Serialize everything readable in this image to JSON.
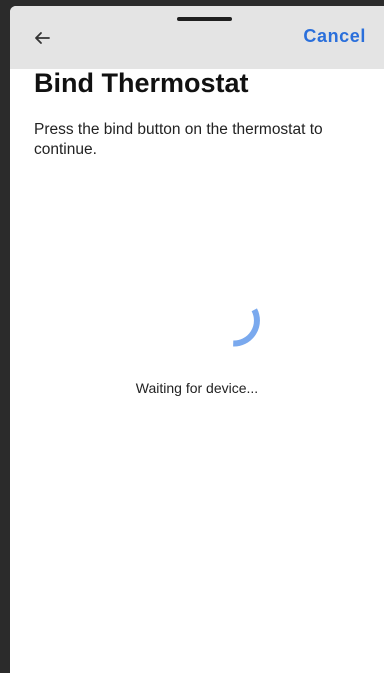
{
  "app_bar": {
    "back_icon": "arrow-left-icon",
    "cancel_label": "Cancel",
    "accent_color": "#2a6fdb"
  },
  "main": {
    "title": "Bind Thermostat",
    "instructions": "Press the bind button on the thermostat to continue.",
    "status_text": "Waiting for device...",
    "spinner_icon": "loading-spinner-icon",
    "spinner_color": "#7aa9ee"
  }
}
